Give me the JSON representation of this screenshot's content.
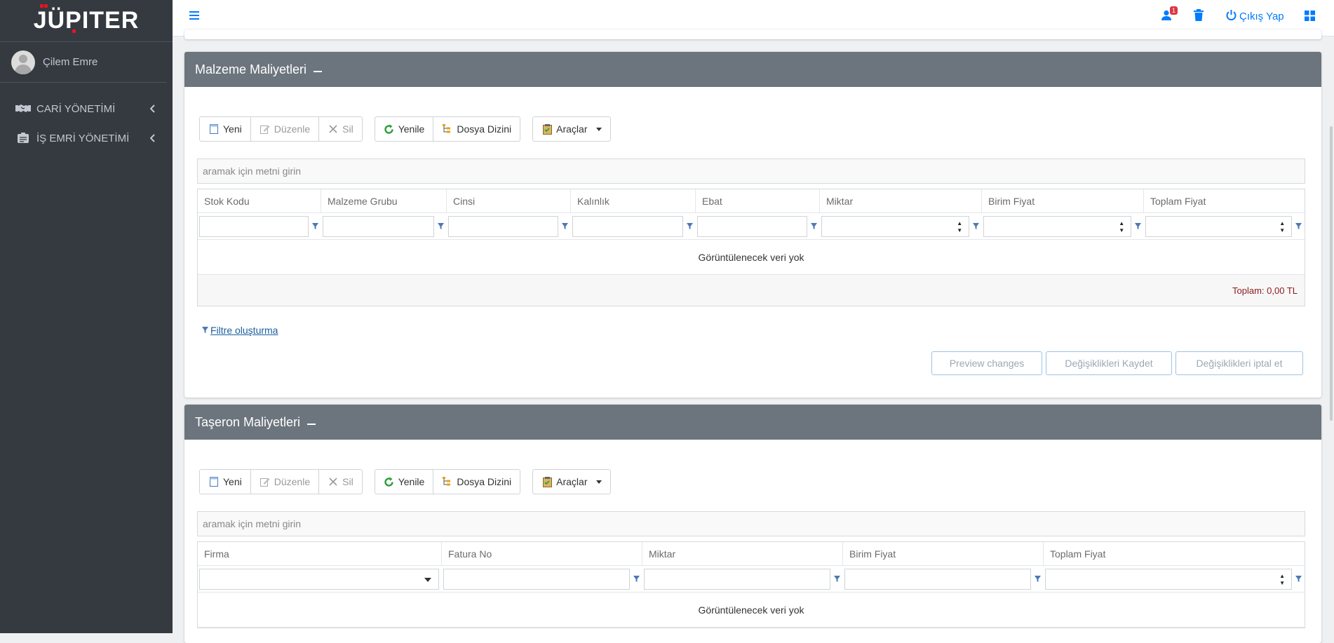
{
  "brand": {
    "name": "JÜPITER"
  },
  "user": {
    "name": "Çilem Emre"
  },
  "sidebar": {
    "items": [
      {
        "label": "CARİ YÖNETİMİ",
        "icon": "handshake-icon"
      },
      {
        "label": "İŞ EMRİ YÖNETİMİ",
        "icon": "tasks-icon"
      }
    ]
  },
  "topbar": {
    "notification_count": "1",
    "logout_label": "Çıkış Yap"
  },
  "toolbar": {
    "new": "Yeni",
    "edit": "Düzenle",
    "delete": "Sil",
    "refresh": "Yenile",
    "folder": "Dosya Dizini",
    "tools": "Araçlar"
  },
  "malzeme": {
    "title": "Malzeme Maliyetleri",
    "search_placeholder": "aramak için metni girin",
    "columns": [
      "Stok Kodu",
      "Malzeme Grubu",
      "Cinsi",
      "Kalınlık",
      "Ebat",
      "Miktar",
      "Birim Fiyat",
      "Toplam Fiyat"
    ],
    "no_data": "Görüntülenecek veri yok",
    "total": "Toplam: 0,00 TL",
    "filter_link": "Filtre oluşturma",
    "preview": "Preview changes",
    "save": "Değişiklikleri Kaydet",
    "cancel": "Değişiklikleri iptal et"
  },
  "taseron": {
    "title": "Taşeron Maliyetleri",
    "search_placeholder": "aramak için metni girin",
    "columns": [
      "Firma",
      "Fatura No",
      "Miktar",
      "Birim Fiyat",
      "Toplam Fiyat"
    ],
    "no_data": "Görüntülenecek veri yok"
  },
  "colors": {
    "sidebar_bg": "#343a40",
    "card_header": "#6c757d",
    "accent": "#007bff",
    "total_text": "#8b1a1a"
  }
}
